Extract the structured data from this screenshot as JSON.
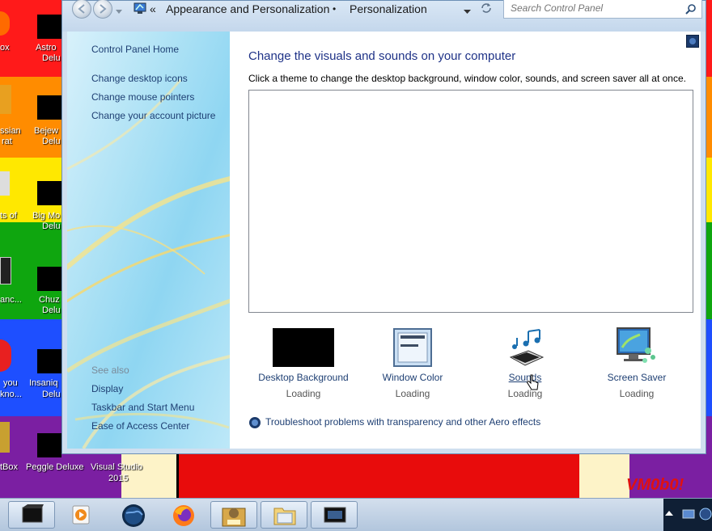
{
  "desktop": {
    "stripes": [
      "#ff1a1a",
      "#ff8c00",
      "#ffe800",
      "#0fa60f",
      "#1e4fff",
      "#7b1fa2"
    ],
    "icon_labels": [
      "ox",
      "Astro",
      "Delu",
      "ssian",
      "rat",
      "Bejew",
      "Delu",
      "ts of",
      "Big Mo",
      "Delu",
      "anc...",
      "Chuz",
      "Delu",
      "you",
      "kno...",
      "Insaniq",
      "Delu",
      "tBox",
      "Peggle Deluxe",
      "Visual Studio",
      "2015"
    ],
    "watermark": "VM0b0!"
  },
  "window": {
    "breadcrumb": [
      "Appearance and Personalization",
      "Personalization"
    ],
    "chevrons": "«",
    "separator": "•",
    "search_placeholder": "Search Control Panel"
  },
  "sidebar": {
    "home_link": "Control Panel Home",
    "links": [
      "Change desktop icons",
      "Change mouse pointers",
      "Change your account picture"
    ],
    "see_also_heading": "See also",
    "see_also_links": [
      "Display",
      "Taskbar and Start Menu",
      "Ease of Access Center"
    ]
  },
  "main": {
    "heading": "Change the visuals and sounds on your computer",
    "description": "Click a theme to change the desktop background, window color, sounds, and screen saver all at once.",
    "tiles": [
      {
        "label": "Desktop Background",
        "status": "Loading",
        "icon": "desktop-background-icon"
      },
      {
        "label": "Window Color",
        "status": "Loading",
        "icon": "window-color-icon"
      },
      {
        "label": "Sounds",
        "status": "Loading",
        "icon": "sounds-icon"
      },
      {
        "label": "Screen Saver",
        "status": "Loading",
        "icon": "screen-saver-icon"
      }
    ],
    "troubleshoot_link": "Troubleshoot problems with transparency and other Aero effects"
  },
  "colors": {
    "link": "#1e3f73",
    "heading": "#1e3287",
    "taskbar": "#c3d3e6"
  }
}
